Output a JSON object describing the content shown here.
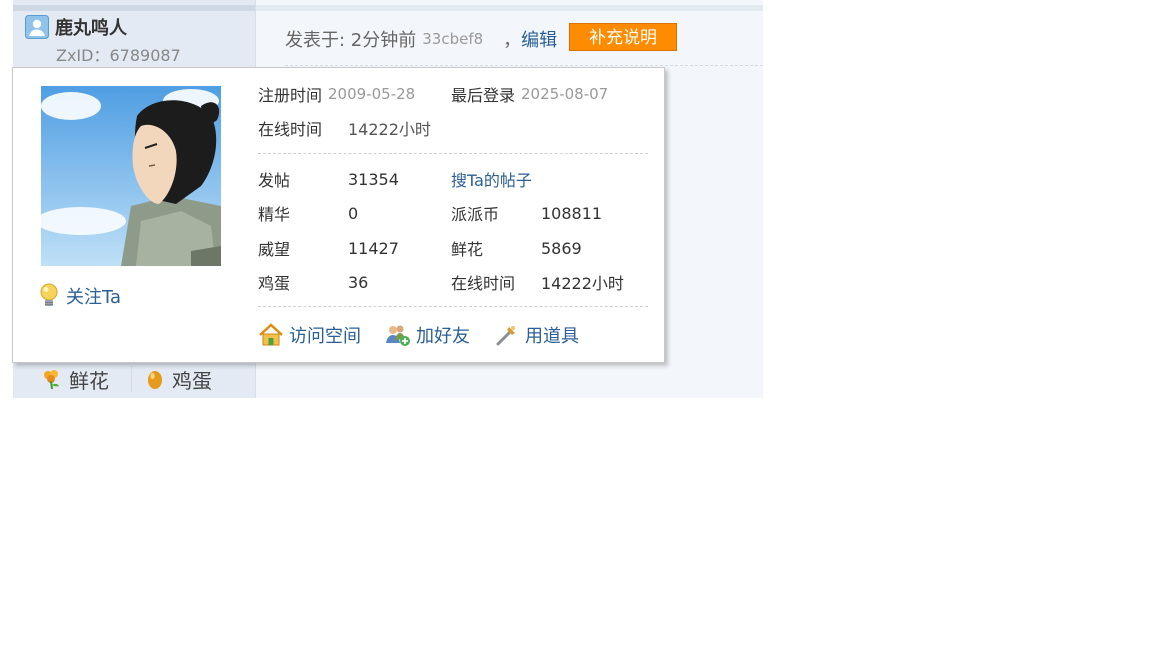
{
  "post": {
    "username": "鹿丸鸣人",
    "zxid": "ZxID：6789087",
    "posted_label": "发表于: 2分钟前",
    "hash": "33cbef8",
    "comma": "，",
    "edit_label": "编辑",
    "supplement_label": "补充说明",
    "flower_label": "鲜花",
    "egg_label": "鸡蛋"
  },
  "card": {
    "reg_label": "注册时间",
    "reg_value": "2009-05-28",
    "last_login_label": "最后登录",
    "last_login_value": "2025-08-07",
    "online_label": "在线时间",
    "online_value": "14222小时",
    "follow_label": "关注Ta",
    "search_posts_label": "搜Ta的帖子",
    "stats": {
      "posts_label": "发帖",
      "posts_value": "31354",
      "digest_label": "精华",
      "digest_value": "0",
      "coins_label": "派派币",
      "coins_value": "108811",
      "prestige_label": "威望",
      "prestige_value": "11427",
      "flowers_label": "鲜花",
      "flowers_value": "5869",
      "eggs_label": "鸡蛋",
      "eggs_value": "36",
      "online2_label": "在线时间",
      "online2_value": "14222小时"
    },
    "actions": {
      "visit_label": "访问空间",
      "friend_label": "加好友",
      "tool_label": "用道具"
    }
  },
  "colors": {
    "accent": "#ff8c00",
    "link": "#2b5f94",
    "sidebar_bg": "#e4eaf3",
    "post_bg": "#f3f7fb"
  },
  "icons": [
    "user-icon",
    "bulb-icon",
    "home-icon",
    "add-friend-icon",
    "tool-icon",
    "flower-icon",
    "egg-icon"
  ]
}
